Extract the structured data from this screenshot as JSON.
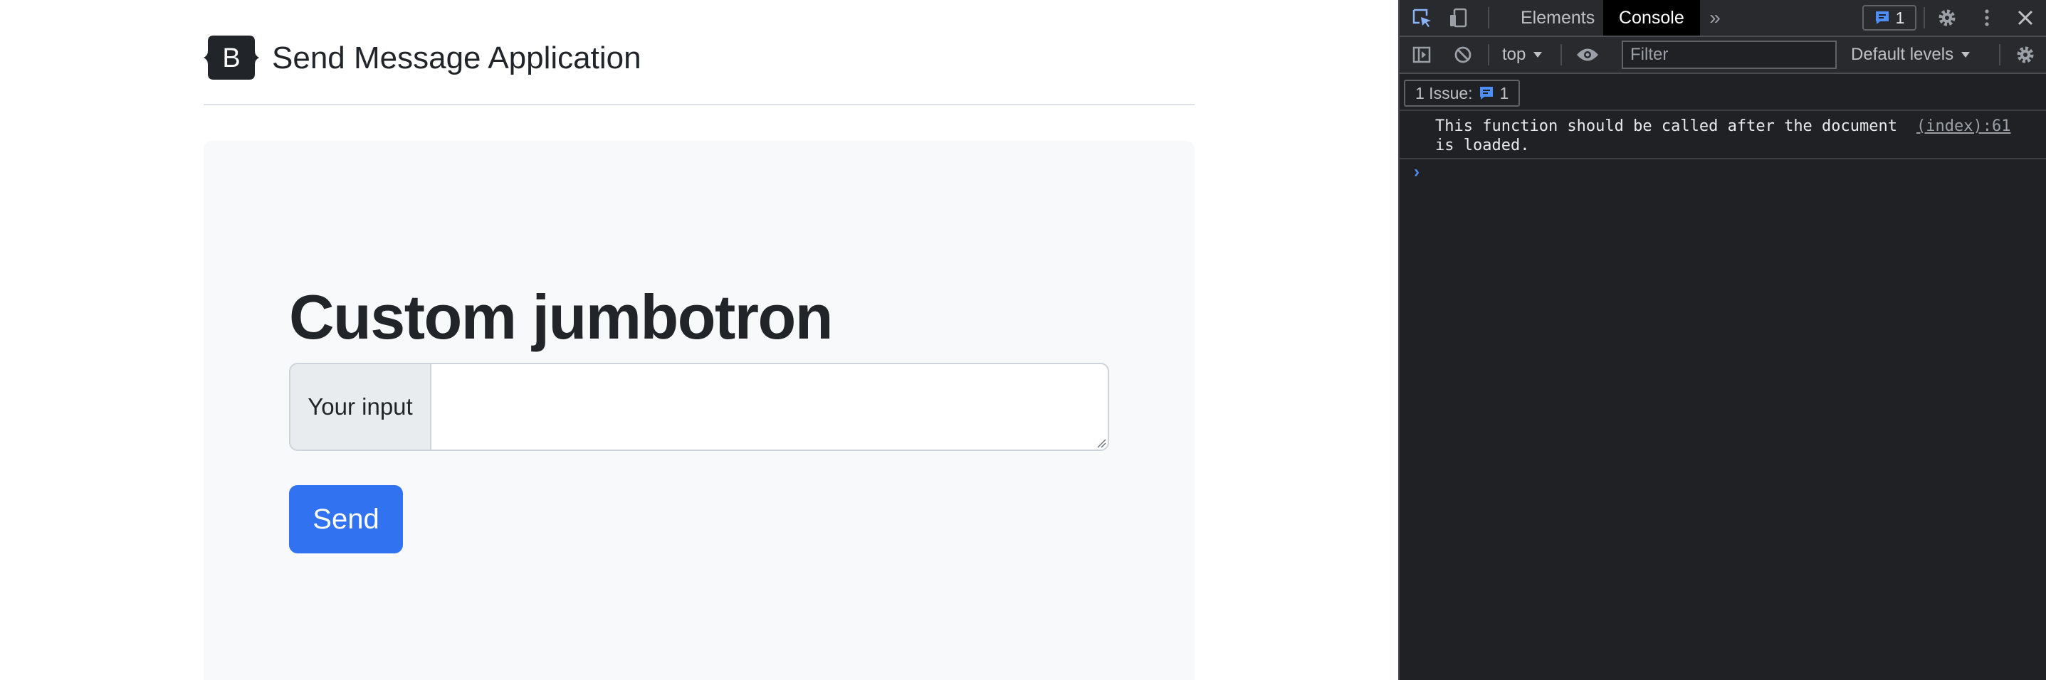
{
  "page": {
    "brand": {
      "logo_letter": "B",
      "title": "Send Message Application"
    },
    "jumbotron": {
      "title": "Custom jumbotron",
      "input_label": "Your input",
      "input_value": "",
      "send_label": "Send"
    }
  },
  "devtools": {
    "tabs": [
      {
        "label": "Elements",
        "active": false
      },
      {
        "label": "Console",
        "active": true
      }
    ],
    "issues_badge_count": "1",
    "context": "top",
    "filter_placeholder": "Filter",
    "levels_label": "Default levels",
    "issues_bar": {
      "label": "1 Issue:",
      "count": "1"
    },
    "messages": [
      {
        "text": "This function should be called after the document\nis loaded.",
        "source": "(index):61"
      }
    ],
    "prompt_symbol": "›"
  },
  "colors": {
    "primary": "#3172f0",
    "devtools_bg": "#202124",
    "devtools_accent": "#4d8ff8",
    "jumbotron_bg": "#f8f9fa"
  },
  "icons": [
    "bootstrap-logo",
    "inspect-element-icon",
    "device-toolbar-icon",
    "more-tabs-icon",
    "issues-message-icon",
    "settings-gear-icon",
    "kebab-menu-icon",
    "close-icon",
    "sidebar-toggle-icon",
    "clear-console-icon",
    "dropdown-triangle-icon",
    "live-expression-eye-icon",
    "console-settings-gear-icon",
    "prompt-chevron-icon"
  ]
}
